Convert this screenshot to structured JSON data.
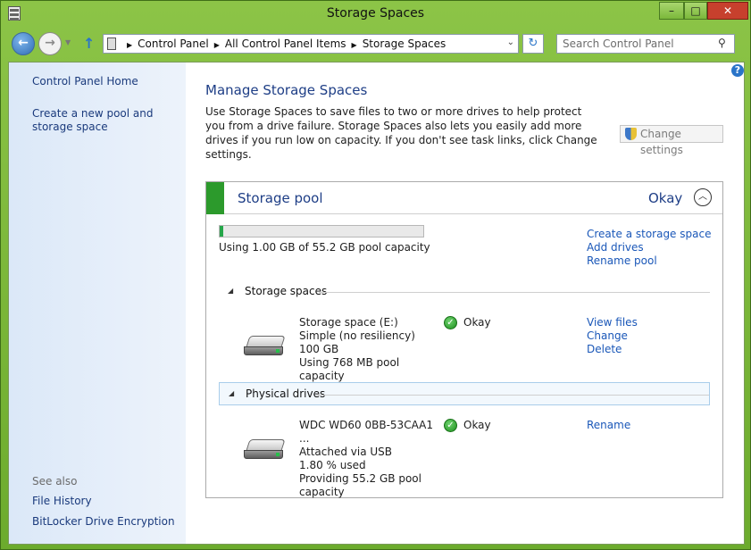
{
  "window": {
    "title": "Storage Spaces",
    "minimize": "–",
    "maximize": "□",
    "close": "✕"
  },
  "address": {
    "breadcrumbs": [
      "Control Panel",
      "All Control Panel Items",
      "Storage Spaces"
    ],
    "search_placeholder": "Search Control Panel"
  },
  "sidebar": {
    "home": "Control Panel Home",
    "create_pool": "Create a new pool and storage space",
    "see_also": "See also",
    "see_also_links": [
      "File History",
      "BitLocker Drive Encryption"
    ]
  },
  "main": {
    "heading": "Manage Storage Spaces",
    "intro": "Use Storage Spaces to save files to two or more drives to help protect you from a drive failure. Storage Spaces also lets you easily add more drives if you run low on capacity. If you don't see task links, click Change settings.",
    "change_settings": "Change settings"
  },
  "pool": {
    "title": "Storage pool",
    "status": "Okay",
    "usage_text": "Using 1.00 GB of 55.2 GB pool capacity",
    "usage_fraction": 0.018,
    "tasks": [
      "Create a storage space",
      "Add drives",
      "Rename pool"
    ],
    "accent_color": "#2c9a2c"
  },
  "storage_spaces": {
    "label": "Storage spaces",
    "items": [
      {
        "lines": [
          "Storage space (E:)",
          "Simple (no resiliency)",
          "100 GB",
          "Using 768 MB pool capacity"
        ],
        "status": "Okay",
        "actions": [
          "View files",
          "Change",
          "Delete"
        ]
      }
    ]
  },
  "physical_drives": {
    "label": "Physical drives",
    "items": [
      {
        "lines": [
          "WDC WD60 0BB-53CAA1 ...",
          "Attached via USB",
          "1.80 % used",
          "Providing 55.2 GB pool capacity"
        ],
        "status": "Okay",
        "actions": [
          "Rename"
        ]
      }
    ]
  }
}
